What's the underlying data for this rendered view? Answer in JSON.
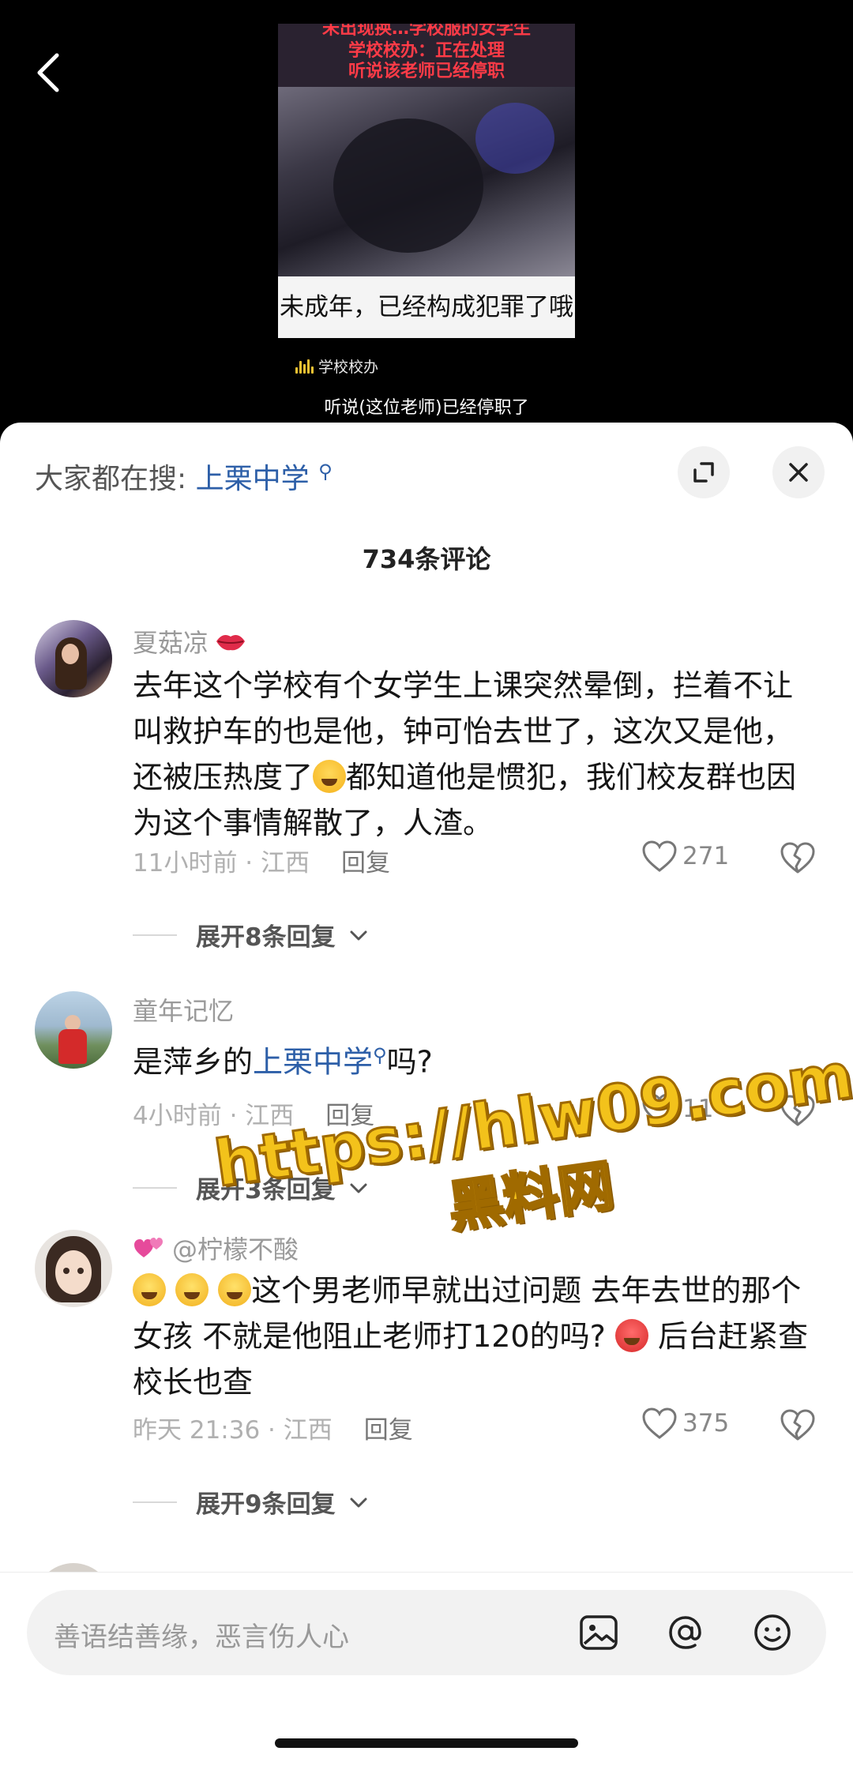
{
  "video": {
    "title_line1": "未出现换…学校服的女学生",
    "title_line2": "学校校办：正在处理",
    "title_line3": "听说该老师已经停职",
    "caption": "未成年，已经构成犯罪了哦",
    "speaker": "学校校办",
    "subtitle": "听说(这位老师)已经停职了"
  },
  "header": {
    "search_prefix": "大家都在搜:",
    "search_keyword": "上栗中学",
    "comment_count": "734条评论"
  },
  "comments": [
    {
      "user": "夏菇凉",
      "text_a": "去年这个学校有个女学生上课突然晕倒，拦着不让叫救护车的也是他，钟可怡去世了，这次又是他，还被压热度了",
      "text_b": "都知道他是惯犯，我们校友群也因为这个事情解散了，人渣。",
      "time": "11小时前 · 江西",
      "reply": "回复",
      "likes": "271",
      "expand": "展开8条回复"
    },
    {
      "user": "童年记忆",
      "text_a": "是萍乡的",
      "keyword": "上栗中学",
      "text_b": "吗?",
      "time": "4小时前 · 江西",
      "reply": "回复",
      "likes": "11",
      "expand": "展开3条回复"
    },
    {
      "user": "@柠檬不酸",
      "text_a": "这个男老师早就出过问题 去年去世的那个女孩 不就是他阻止老师打120的吗?",
      "text_b": "后台赶紧查 校长也查",
      "time": "昨天 21:36 · 江西",
      "reply": "回复",
      "likes": "375",
      "expand": "展开9条回复"
    }
  ],
  "watermark": {
    "url": "https://hlw09.com",
    "name": "黑料网"
  },
  "input": {
    "placeholder": "善语结善缘，恶言伤人心"
  },
  "colors": {
    "keyword_blue": "#2d5fa8",
    "watermark_yellow": "#f3c21b"
  }
}
